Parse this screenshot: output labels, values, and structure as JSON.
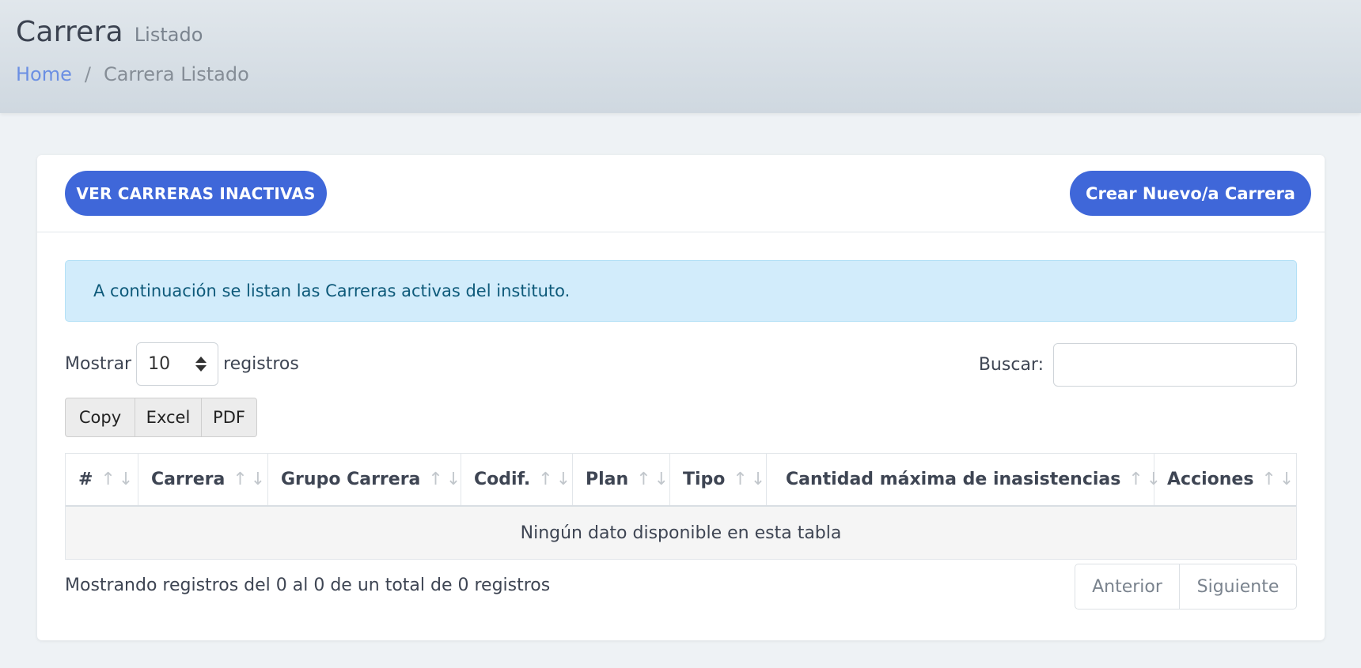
{
  "header": {
    "title": "Carrera",
    "subtitle": "Listado",
    "breadcrumb": {
      "home": "Home",
      "separator": "/",
      "current": "Carrera Listado"
    }
  },
  "actions": {
    "inactive_label": "VER CARRERAS INACTIVAS",
    "create_label": "Crear Nuevo/a Carrera"
  },
  "alert": {
    "text": "A continuación se listan las Carreras activas del instituto."
  },
  "length_control": {
    "prefix": "Mostrar",
    "value": "10",
    "suffix": "registros"
  },
  "search": {
    "label": "Buscar:",
    "value": "",
    "placeholder": ""
  },
  "export_buttons": {
    "copy": "Copy",
    "excel": "Excel",
    "pdf": "PDF"
  },
  "table": {
    "sort_indicator": "↑↓",
    "columns": [
      "#",
      "Carrera",
      "Grupo Carrera",
      "Codif.",
      "Plan",
      "Tipo",
      "Cantidad máxima de inasistencias",
      "Acciones"
    ],
    "empty_message": "Ningún dato disponible en esta tabla"
  },
  "footer": {
    "info": "Mostrando registros del 0 al 0 de un total de 0 registros",
    "prev_label": "Anterior",
    "next_label": "Siguiente"
  },
  "colors": {
    "primary": "#3f67d9",
    "alert_bg": "#d2ecfb",
    "alert_text": "#0e5a7a",
    "link": "#6b8fe3"
  }
}
